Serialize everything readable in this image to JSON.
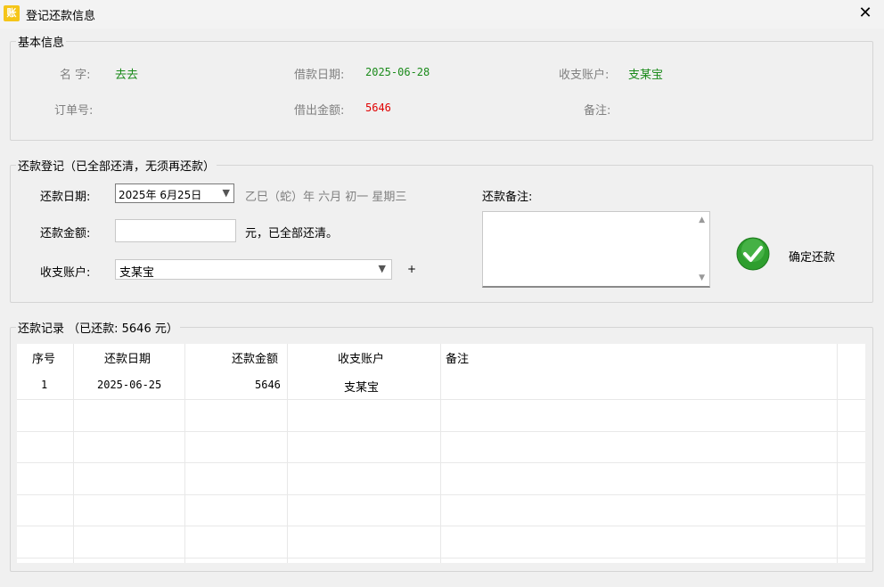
{
  "window": {
    "icon_char": "账",
    "title": "登记还款信息",
    "close_glyph": "✕"
  },
  "basic_info": {
    "group_title": "基本信息",
    "name_label": "名 字:",
    "name_value": "去去",
    "borrow_date_label": "借款日期:",
    "borrow_date_value": "2025-06-28",
    "account_label": "收支账户:",
    "account_value": "支某宝",
    "order_label": "订单号:",
    "order_value": "",
    "amount_label": "借出金额:",
    "amount_value": "5646",
    "remark_label": "备注:",
    "remark_value": ""
  },
  "repay_form": {
    "group_title": "还款登记（已全部还清，无须再还款）",
    "date_label": "还款日期:",
    "date_value": "2025年 6月25日",
    "lunar_text": "乙巳（蛇）年 六月 初一 星期三",
    "amount_label": "还款金额:",
    "amount_value": "",
    "amount_suffix": "元，已全部还清。",
    "account_label": "收支账户:",
    "account_value": "支某宝",
    "plus": "+",
    "remark_label": "还款备注:",
    "remark_value": "",
    "confirm_label": "确定还款"
  },
  "records": {
    "group_title": "还款记录 （已还款: 5646 元）",
    "columns": [
      "序号",
      "还款日期",
      "还款金额",
      "收支账户",
      "备注"
    ],
    "rows": [
      {
        "index": "1",
        "date": "2025-06-25",
        "amount": "5646",
        "account": "支某宝",
        "remark": ""
      }
    ]
  },
  "colors": {
    "green_value": "#1a8a1a",
    "red_value": "#e00000",
    "check_green": "#2e9e2e"
  }
}
